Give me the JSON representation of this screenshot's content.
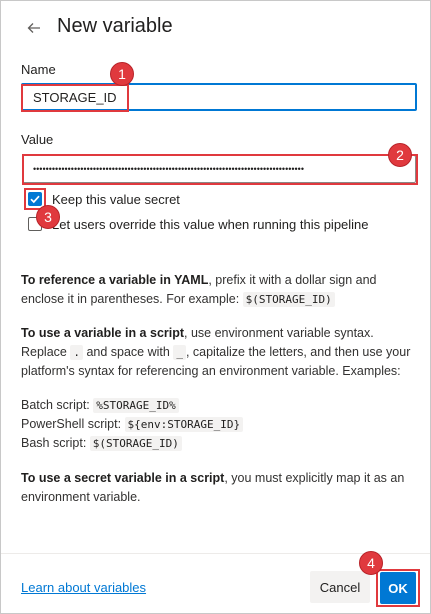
{
  "dialog": {
    "title": "New variable"
  },
  "fields": {
    "name_label": "Name",
    "name_value": "STORAGE_ID",
    "value_label": "Value",
    "value_masked": "••••••••••••••••••••••••••••••••••••••••••••••••••••••••••••••••••••••••••••••••••••••"
  },
  "options": {
    "keep_secret_label": "Keep this value secret",
    "keep_secret_checked": true,
    "override_label": "Let users override this value when running this pipeline",
    "override_checked": false
  },
  "help": {
    "yaml_bold": "To reference a variable in YAML",
    "yaml_text": ", prefix it with a dollar sign and enclose it in parentheses. For example: ",
    "yaml_code": "$(STORAGE_ID)",
    "script_bold": "To use a variable in a script",
    "script_text1": ", use environment variable syntax. Replace ",
    "script_code1": ".",
    "script_text2": " and space with ",
    "script_code2": "_",
    "script_text3": ", capitalize the letters, and then use your platform's syntax for referencing an environment variable. Examples:",
    "batch_label": "Batch script: ",
    "batch_code": "%STORAGE_ID%",
    "powershell_label": "PowerShell script: ",
    "powershell_code": "${env:STORAGE_ID}",
    "bash_label": "Bash script: ",
    "bash_code": "$(STORAGE_ID)",
    "secret_bold": "To use a secret variable in a script",
    "secret_text": ", you must explicitly map it as an environment variable."
  },
  "footer": {
    "learn_link": "Learn about variables",
    "cancel_label": "Cancel",
    "ok_label": "OK"
  },
  "annotations": {
    "badge1": "1",
    "badge2": "2",
    "badge3": "3",
    "badge4": "4"
  },
  "colors": {
    "accent": "#0078d4",
    "highlight": "#e0393e"
  }
}
